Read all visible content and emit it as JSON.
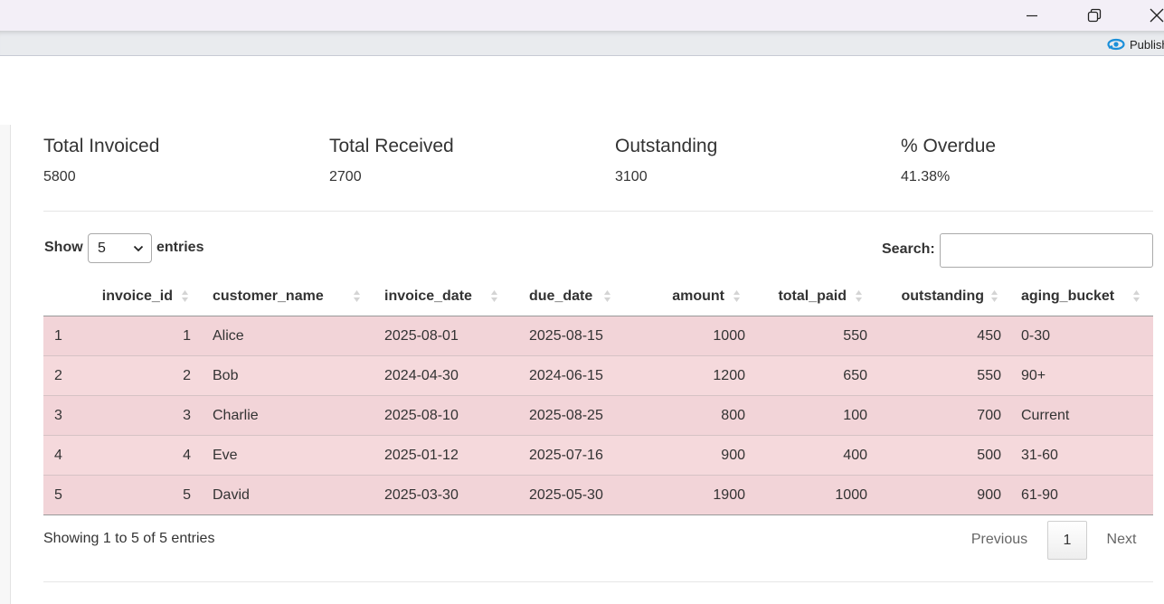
{
  "window": {
    "controls": [
      "minimize-icon",
      "restore-icon",
      "close-icon"
    ]
  },
  "toolbar": {
    "publish_label": "Publish",
    "publish_icon": "publish-icon",
    "accent": "#1a8fd9"
  },
  "kpis": [
    {
      "label": "Total Invoiced",
      "value": "5800"
    },
    {
      "label": "Total Received",
      "value": "2700"
    },
    {
      "label": "Outstanding",
      "value": "3100"
    },
    {
      "label": "% Overdue",
      "value": "41.38%"
    }
  ],
  "datatable": {
    "show_label": "Show",
    "length_value": "5",
    "entries_label": "entries",
    "search_label": "Search:",
    "search_value": "",
    "columns": [
      "invoice_id",
      "customer_name",
      "invoice_date",
      "due_date",
      "amount",
      "total_paid",
      "outstanding",
      "aging_bucket"
    ],
    "rows": [
      {
        "row": "1",
        "invoice_id": "1",
        "customer_name": "Alice",
        "invoice_date": "2025-08-01",
        "due_date": "2025-08-15",
        "amount": "1000",
        "total_paid": "550",
        "outstanding": "450",
        "aging_bucket": "0-30"
      },
      {
        "row": "2",
        "invoice_id": "2",
        "customer_name": "Bob",
        "invoice_date": "2024-04-30",
        "due_date": "2024-06-15",
        "amount": "1200",
        "total_paid": "650",
        "outstanding": "550",
        "aging_bucket": "90+"
      },
      {
        "row": "3",
        "invoice_id": "3",
        "customer_name": "Charlie",
        "invoice_date": "2025-08-10",
        "due_date": "2025-08-25",
        "amount": "800",
        "total_paid": "100",
        "outstanding": "700",
        "aging_bucket": "Current"
      },
      {
        "row": "4",
        "invoice_id": "4",
        "customer_name": "Eve",
        "invoice_date": "2025-01-12",
        "due_date": "2025-07-16",
        "amount": "900",
        "total_paid": "400",
        "outstanding": "500",
        "aging_bucket": "31-60"
      },
      {
        "row": "5",
        "invoice_id": "5",
        "customer_name": "David",
        "invoice_date": "2025-03-30",
        "due_date": "2025-05-30",
        "amount": "1900",
        "total_paid": "1000",
        "outstanding": "900",
        "aging_bucket": "61-90"
      }
    ],
    "row_color": "#f2d4d8",
    "info": "Showing 1 to 5 of 5 entries",
    "pagination": {
      "previous": "Previous",
      "current_page": "1",
      "next": "Next"
    }
  }
}
